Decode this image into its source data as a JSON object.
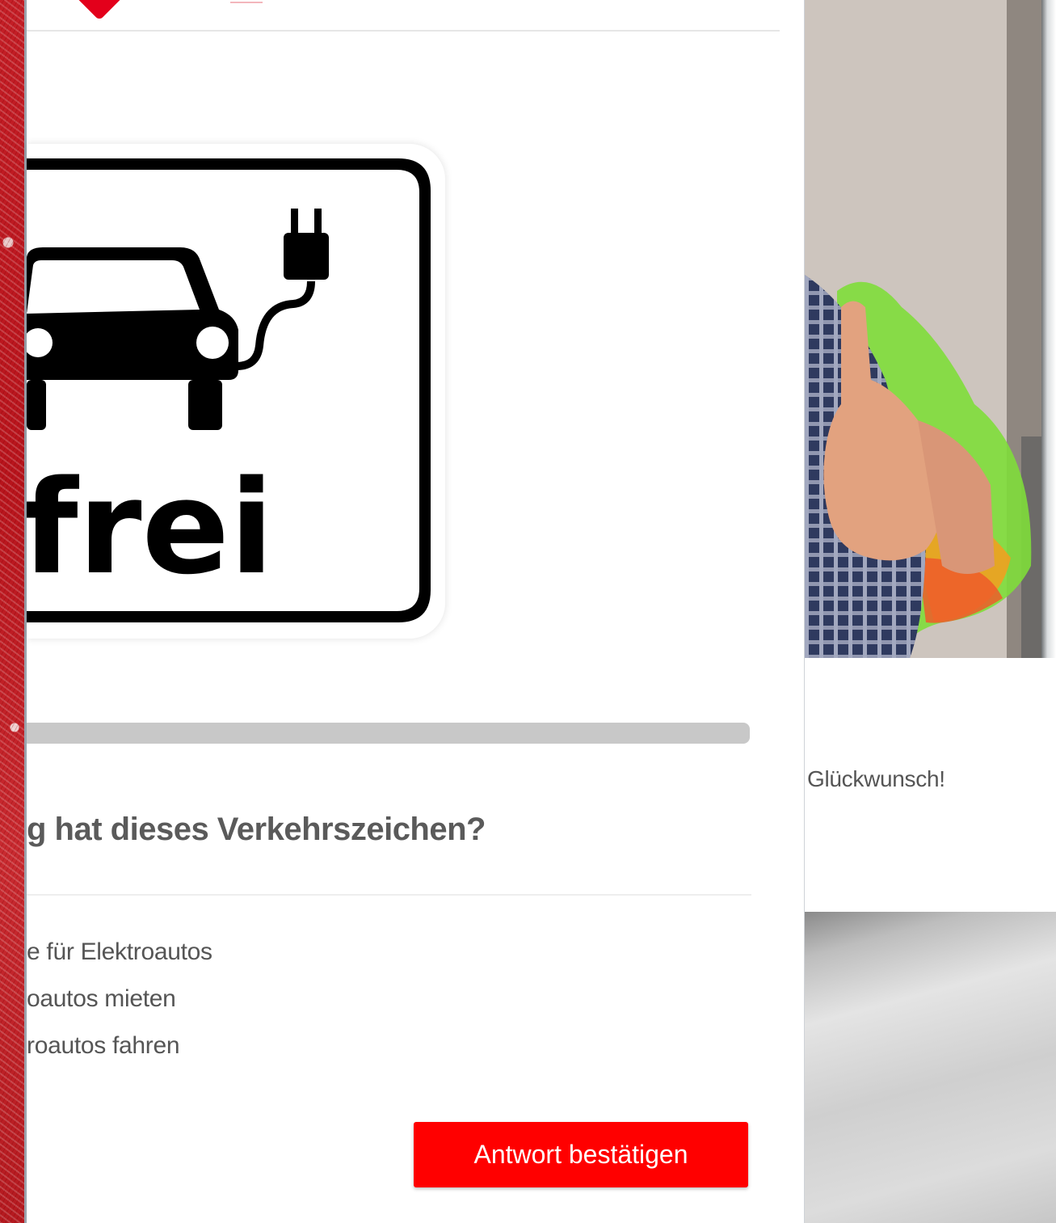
{
  "header": {
    "logo_icon": "heart-logo-icon"
  },
  "sign": {
    "text": "frei",
    "icon": "electric-car-plug-icon"
  },
  "quiz": {
    "progress_percent": 100,
    "question": "g hat dieses Verkehrszeichen?",
    "answers": [
      "e für Elektroautos",
      "oautos mieten",
      "roautos fahren"
    ],
    "confirm_label": "Antwort bestätigen"
  },
  "side": {
    "congrats_text": "Glückwunsch!"
  },
  "colors": {
    "brand_red": "#ff0000",
    "progress_gray": "#c8c8c8",
    "question_text": "#5a5a5a"
  }
}
